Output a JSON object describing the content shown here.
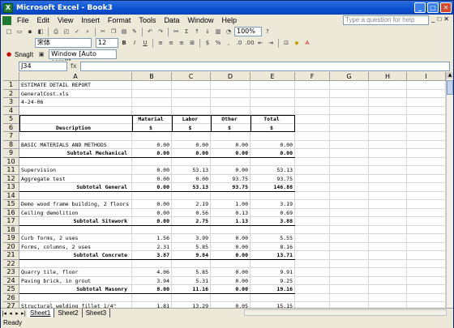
{
  "window": {
    "title": "Microsoft Excel - Book3"
  },
  "menu": [
    "File",
    "Edit",
    "View",
    "Insert",
    "Format",
    "Tools",
    "Data",
    "Window",
    "Help"
  ],
  "help_placeholder": "Type a question for help",
  "toolbar": {
    "zoom": "100%",
    "font": "宋体",
    "font_size": "12",
    "snagit": "SnagIt",
    "window_select": "Window [Auto scroll]"
  },
  "formula": {
    "namebox": "J34",
    "fx": "fx"
  },
  "columns": [
    "A",
    "B",
    "C",
    "D",
    "E",
    "F",
    "G",
    "H",
    "I"
  ],
  "rows": [
    {
      "n": "1",
      "a": "ESTIMATE DETAIL REPORT"
    },
    {
      "n": "2",
      "a": "GeneralCost.xls"
    },
    {
      "n": "3",
      "a": "4-24-06"
    },
    {
      "n": "4"
    },
    {
      "n": "5",
      "b": "Material",
      "c": "Labor",
      "d": "Other",
      "e": "Total",
      "hdr": true
    },
    {
      "n": "6",
      "a": "Description",
      "b": "$",
      "c": "$",
      "d": "$",
      "e": "$",
      "hdr": true
    },
    {
      "n": "7"
    },
    {
      "n": "8",
      "a": "BASIC MATERIALS AND METHODS",
      "b": "0.00",
      "c": "0.00",
      "d": "0.00",
      "e": "0.00"
    },
    {
      "n": "9",
      "a": "Subtotal Mechanical",
      "b": "0.00",
      "c": "0.00",
      "d": "0.00",
      "e": "0.00",
      "sub": true
    },
    {
      "n": "10"
    },
    {
      "n": "11",
      "a": "Supervision",
      "b": "0.00",
      "c": "53.13",
      "d": "0.00",
      "e": "53.13"
    },
    {
      "n": "12",
      "a": "Aggregate test",
      "b": "0.00",
      "c": "0.00",
      "d": "93.75",
      "e": "93.75"
    },
    {
      "n": "13",
      "a": "Subtotal General",
      "b": "0.00",
      "c": "53.13",
      "d": "93.75",
      "e": "146.88",
      "sub": true
    },
    {
      "n": "14"
    },
    {
      "n": "15",
      "a": "Demo wood frame building, 2 floors",
      "b": "0.00",
      "c": "2.19",
      "d": "1.00",
      "e": "3.19"
    },
    {
      "n": "16",
      "a": "Ceiling demolition",
      "b": "0.00",
      "c": "0.56",
      "d": "0.13",
      "e": "0.69"
    },
    {
      "n": "17",
      "a": "Subtotal Sitework",
      "b": "0.00",
      "c": "2.75",
      "d": "1.13",
      "e": "3.88",
      "sub": true
    },
    {
      "n": "18"
    },
    {
      "n": "19",
      "a": "Curb forms, 2 uses",
      "b": "1.56",
      "c": "3.99",
      "d": "0.00",
      "e": "5.55"
    },
    {
      "n": "20",
      "a": "Forms, columns, 2 uses",
      "b": "2.31",
      "c": "5.85",
      "d": "0.00",
      "e": "8.16"
    },
    {
      "n": "21",
      "a": "Subtotal Concrete",
      "b": "3.87",
      "c": "9.84",
      "d": "0.00",
      "e": "13.71",
      "sub": true
    },
    {
      "n": "22"
    },
    {
      "n": "23",
      "a": "Quarry tile, floor",
      "b": "4.06",
      "c": "5.85",
      "d": "0.00",
      "e": "9.91"
    },
    {
      "n": "24",
      "a": "Paving brick, in grout",
      "b": "3.94",
      "c": "5.31",
      "d": "0.00",
      "e": "9.25"
    },
    {
      "n": "25",
      "a": "Subtotal Masonry",
      "b": "8.00",
      "c": "11.16",
      "d": "0.00",
      "e": "19.16",
      "sub": true
    },
    {
      "n": "26"
    },
    {
      "n": "27",
      "a": "Structural welding fillet 1/4\"",
      "b": "1.81",
      "c": "13.29",
      "d": "0.05",
      "e": "15.15"
    }
  ],
  "sheets": [
    "Sheet1",
    "Sheet2",
    "Sheet3"
  ],
  "status": "Ready"
}
